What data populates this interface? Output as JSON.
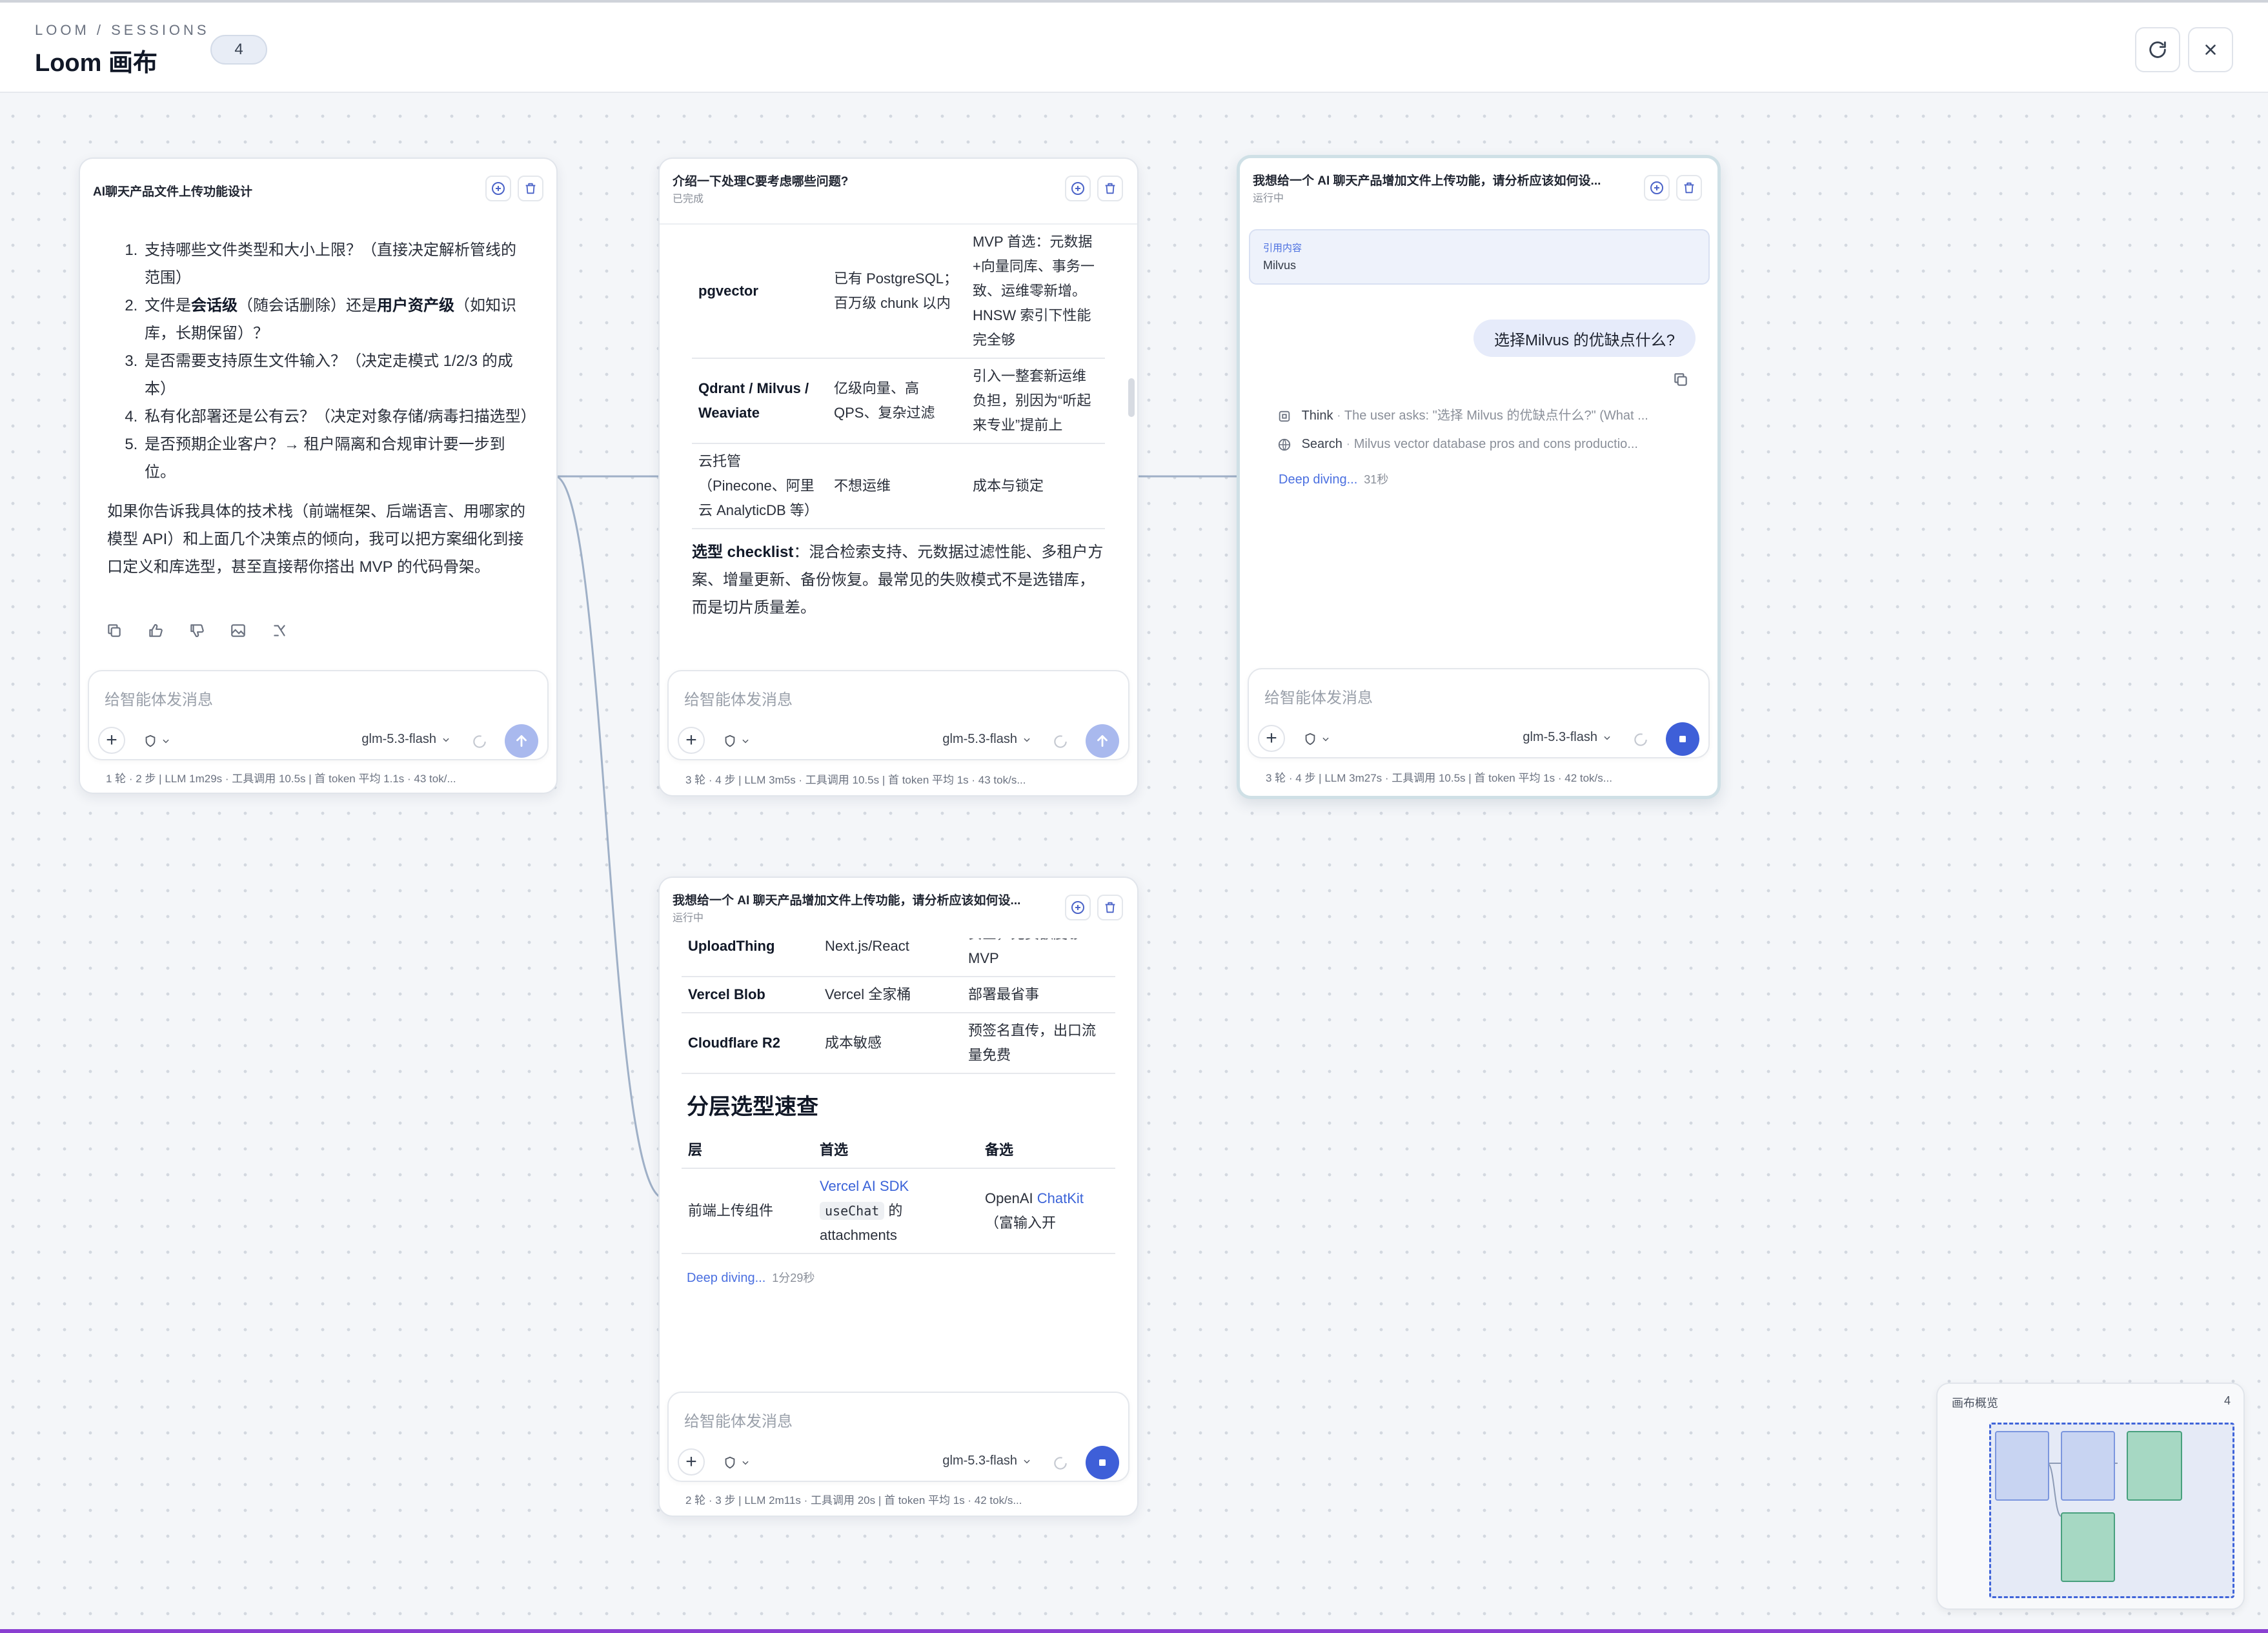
{
  "header": {
    "kicker": "LOOM / SESSIONS",
    "title": "Loom 画布",
    "badge": "4",
    "refresh_icon": "refresh-icon",
    "close_icon": "close-icon"
  },
  "colors": {
    "accent": "#3e5fd8",
    "send_idle": "#a9b9ee",
    "edge": "#9fb0c7",
    "minimap_blue": "#c8d4f2",
    "minimap_green": "#a6d8c3",
    "bottom_bar": "#8a3fd1"
  },
  "common": {
    "input_placeholder": "给智能体发消息",
    "model": "glm-5.3-flash"
  },
  "card1": {
    "title": "AI聊天产品文件上传功能设计",
    "list": [
      "支持哪些文件类型和大小上限？（直接决定解析管线的范围）",
      "是否需要支持原生文件输入？（决定走模式 1/2/3 的成本）",
      "私有化部署还是公有云？（决定对象存储/病毒扫描选型）",
      "是否预期企业客户？→ 租户隔离和合规审计要一步到位。"
    ],
    "item2": {
      "pre": "文件是",
      "b1": "会话级",
      "mid": "（随会话删除）还是",
      "b2": "用户资产级",
      "post": "（如知识库，长期保留）？"
    },
    "paragraph": "如果你告诉我具体的技术栈（前端框架、后端语言、用哪家的模型 API）和上面几个决策点的倾向，我可以把方案细化到接口定义和库选型，甚至直接帮你搭出 MVP 的代码骨架。",
    "stats": "1 轮 · 2 步   |   LLM 1m29s · 工具调用 10.5s   |   首 token 平均 1.1s · 43 tok/..."
  },
  "card2": {
    "title": "介绍一下处理C要考虑哪些问题?",
    "status": "已完成",
    "rows": [
      [
        "pgvector",
        "已有 PostgreSQL；百万级 chunk 以内",
        "MVP 首选：元数据+向量同库、事务一致、运维零新增。HNSW 索引下性能完全够"
      ],
      [
        "Qdrant / Milvus / Weaviate",
        "亿级向量、高 QPS、复杂过滤",
        "引入一整套新运维负担，别因为“听起来专业”提前上"
      ],
      [
        "云托管（Pinecone、阿里云 AnalyticDB 等）",
        "不想运维",
        "成本与锁定"
      ]
    ],
    "checklist_label": "选型 checklist",
    "checklist_text": "：混合检索支持、元数据过滤性能、多租户方案、增量更新、备份恢复。最常见的失败模式不是选错库，而是切片质量差。",
    "stats": "3 轮 · 4 步   |   LLM 3m5s · 工具调用 10.5s   |   首 token 平均 1s · 43 tok/s..."
  },
  "card3": {
    "title": "我想给一个 AI 聊天产品增加文件上传功能，请分析应该如何设...",
    "status": "运行中",
    "quote_label": "引用内容",
    "quote_text": "Milvus",
    "user_message": "选择Milvus 的优缺点什么?",
    "steps": [
      {
        "icon": "think-icon",
        "label": "Think",
        "text": "The user asks: \"选择 Milvus 的优缺点什么?\" (What ..."
      },
      {
        "icon": "globe-icon",
        "label": "Search",
        "text": "Milvus vector database pros and cons productio..."
      }
    ],
    "deep_label": "Deep diving...",
    "deep_time": "31秒",
    "stats": "3 轮 · 4 步   |   LLM 3m27s · 工具调用 10.5s   |   首 token 平均 1s · 42 tok/s..."
  },
  "card4": {
    "title": "我想给一个 AI 聊天产品增加文件上传功能，请分析应该如何设...",
    "status": "运行中",
    "top_rows": [
      [
        "UploadThing",
        "Next.js/React",
        "安全，免费额度够 MVP"
      ],
      [
        "Vercel Blob",
        "Vercel 全家桶",
        "部署最省事"
      ],
      [
        "Cloudflare R2",
        "成本敏感",
        "预签名直传，出口流量免费"
      ]
    ],
    "section_title": "分层选型速查",
    "headers": [
      "层",
      "首选",
      "备选"
    ],
    "row": {
      "layer": "前端上传组件",
      "primary_link": "Vercel AI SDK",
      "primary_code": "useChat",
      "primary_rest1": " 的",
      "primary_rest2": "attachments",
      "alt_pre": "OpenAI ",
      "alt_link": "ChatKit",
      "alt_post": "（富输入开"
    },
    "deep_label": "Deep diving...",
    "deep_time": "1分29秒",
    "stats": "2 轮 · 3 步   |   LLM 2m11s · 工具调用 20s   |   首 token 平均 1s · 42 tok/s..."
  },
  "minimap": {
    "title": "画布概览",
    "count": "4"
  }
}
